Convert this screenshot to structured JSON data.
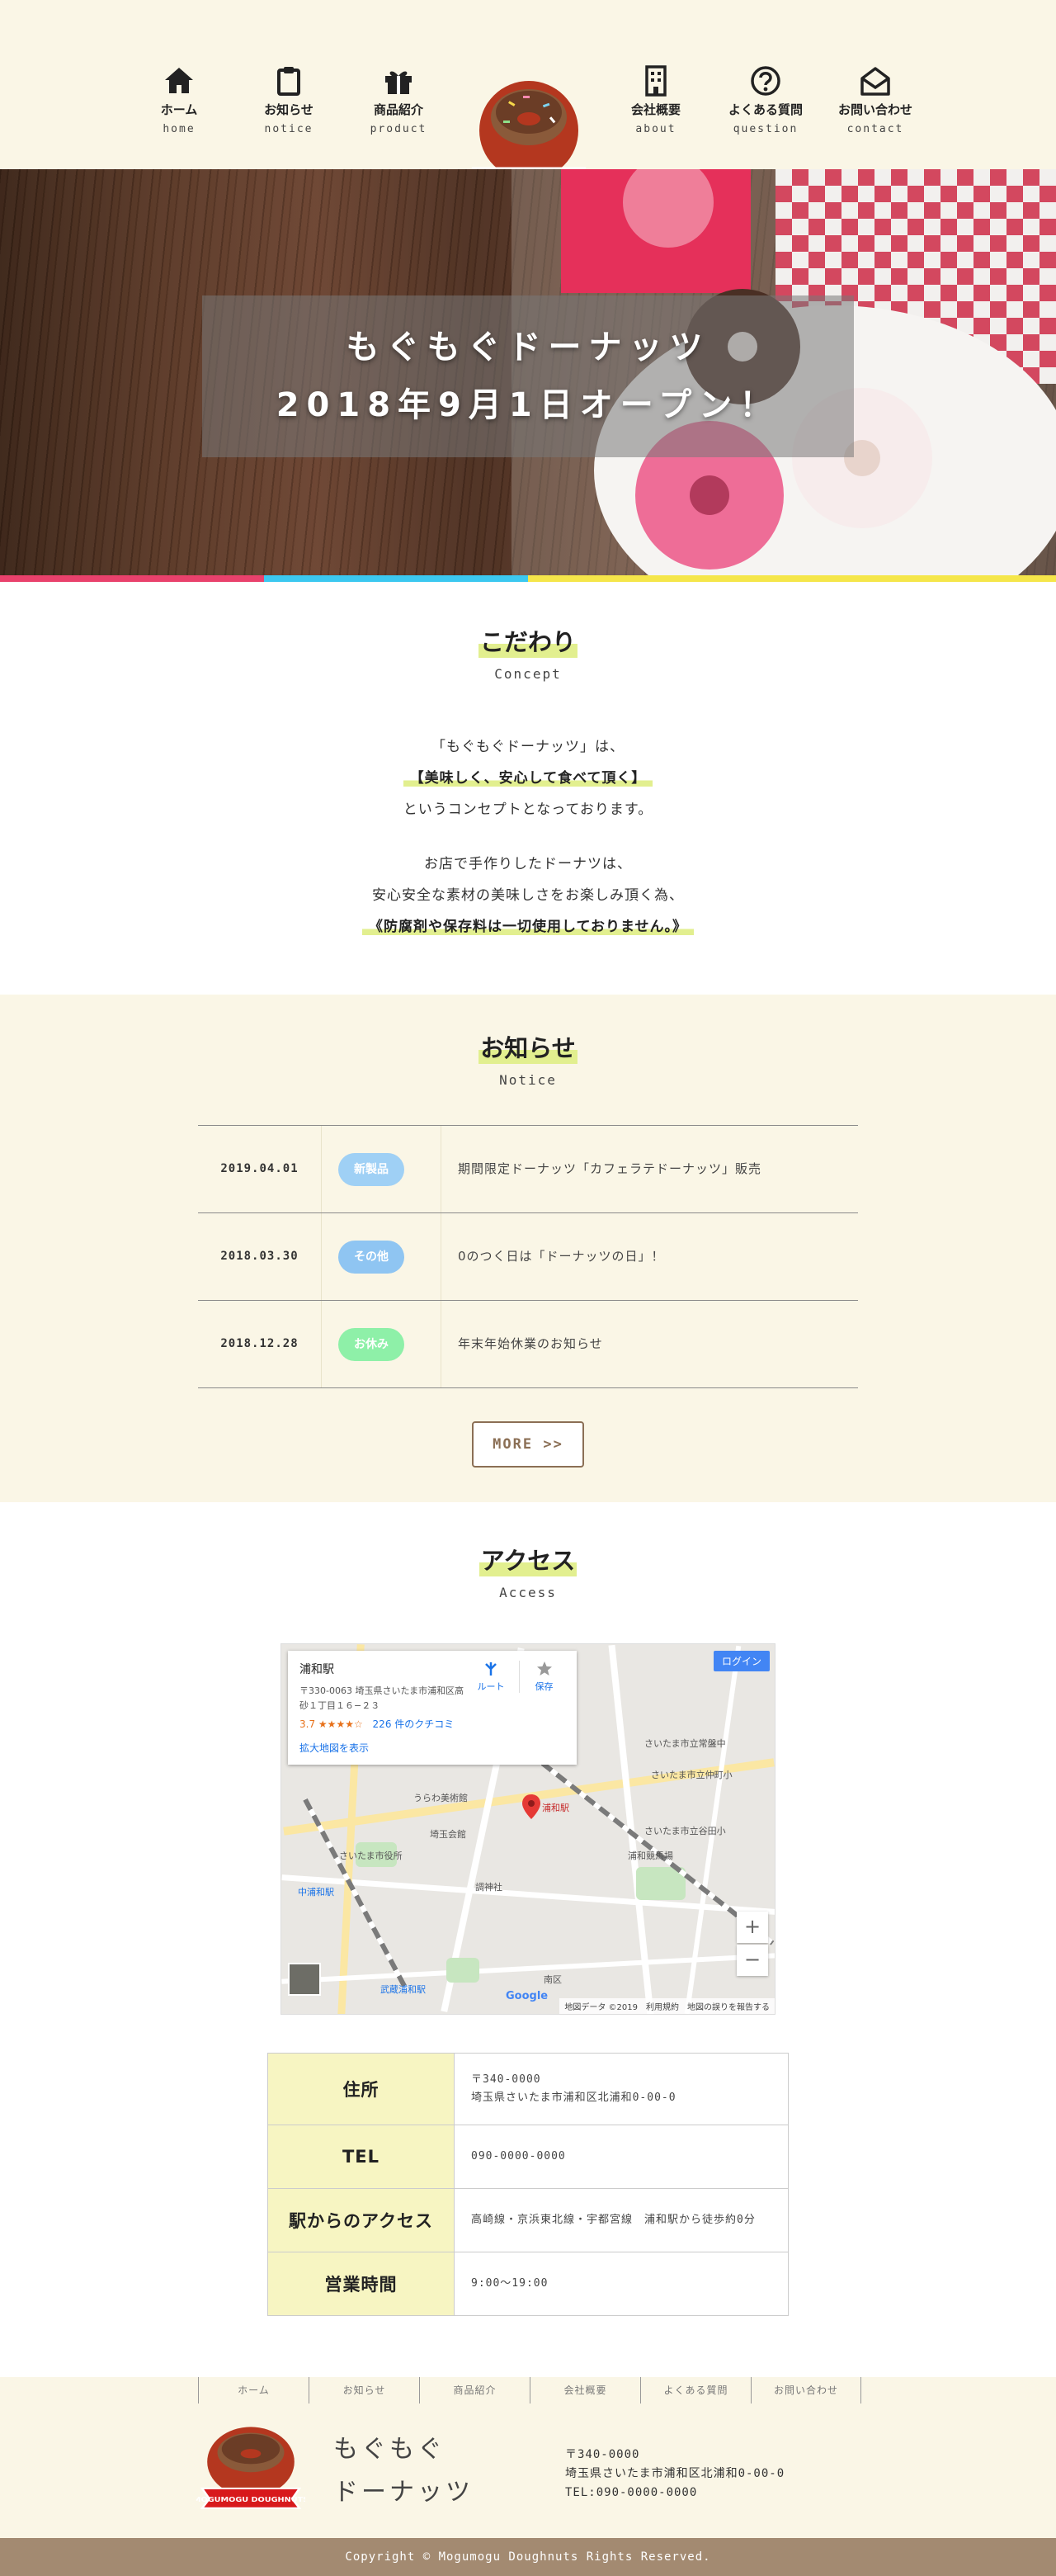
{
  "colors": {
    "cream": "#faf6e6",
    "highlight": "#e2ef8f",
    "brown": "#8b6f55",
    "footer_brown": "#a38a71",
    "badge_new": "#9fd0f5",
    "badge_other": "#8fc5f2",
    "badge_holiday": "#8ef0a8",
    "bar_colors": [
      "#e9416c",
      "#3cc8f0",
      "#f5e64a",
      "#f5e64a"
    ]
  },
  "header": {
    "logo_text": "MOGUMOGU DOUGHNUTS",
    "nav": [
      {
        "jp": "ホーム",
        "en": "home",
        "icon": "home-icon"
      },
      {
        "jp": "お知らせ",
        "en": "notice",
        "icon": "clipboard-icon"
      },
      {
        "jp": "商品紹介",
        "en": "product",
        "icon": "gift-icon"
      },
      {
        "jp": "会社概要",
        "en": "about",
        "icon": "building-icon"
      },
      {
        "jp": "よくある質問",
        "en": "question",
        "icon": "question-icon"
      },
      {
        "jp": "お問い合わせ",
        "en": "contact",
        "icon": "mail-open-icon"
      }
    ]
  },
  "hero": {
    "line1": "もぐもぐドーナッツ",
    "line2": "2018年9月1日オープン！"
  },
  "concept": {
    "title": "こだわり",
    "subtitle": "Concept",
    "p1_line1": "「もぐもぐドーナッツ」は、",
    "p1_line2": "【美味しく、安心して食べて頂く】",
    "p1_line3": "というコンセプトとなっております。",
    "p2_line1": "お店で手作りしたドーナツは、",
    "p2_line2": "安心安全な素材の美味しさをお楽しみ頂く為、",
    "p2_line3": "《防腐剤や保存料は一切使用しておりません。》"
  },
  "notice": {
    "title": "お知らせ",
    "subtitle": "Notice",
    "items": [
      {
        "date": "2019.04.01",
        "badge": "新製品",
        "text": "期間限定ドーナッツ「カフェラテドーナッツ」販売"
      },
      {
        "date": "2018.03.30",
        "badge": "その他",
        "text": "0のつく日は「ドーナッツの日」！"
      },
      {
        "date": "2018.12.28",
        "badge": "お休み",
        "text": "年末年始休業のお知らせ"
      }
    ],
    "more_label": "MORE >>"
  },
  "access": {
    "title": "アクセス",
    "subtitle": "Access",
    "map": {
      "place_name": "浦和駅",
      "place_address": "〒330-0063 埼玉県さいたま市浦和区高砂１丁目１６−２３",
      "rating": "3.7",
      "stars": "★★★★☆",
      "reviews": "226 件のクチコミ",
      "large_map_link": "拡大地図を表示",
      "route_label": "ルート",
      "save_label": "保存",
      "login_label": "ログイン",
      "pin_label": "浦和駅",
      "zoom_in": "+",
      "zoom_out": "−",
      "footer": "地図データ ©2019　利用規約　地図の誤りを報告する",
      "google": "Google",
      "labels": [
        "うらわ美術館",
        "埼玉会館",
        "さいたま市役所",
        "調神社",
        "浦和競馬場",
        "南区",
        "中浦和駅",
        "武蔵浦和駅",
        "さいたま市立谷田小",
        "さいたま市立仲町小",
        "さいたま市立常盤中"
      ]
    },
    "table": [
      {
        "label": "住所",
        "value": "〒340-0000\n埼玉県さいたま市浦和区北浦和0-00-0"
      },
      {
        "label": "TEL",
        "value": "090-0000-0000"
      },
      {
        "label": "駅からのアクセス",
        "value": "高崎線・京浜東北線・宇都宮線　浦和駅から徒歩約0分"
      },
      {
        "label": "営業時間",
        "value": "9:00〜19:00"
      }
    ]
  },
  "footer": {
    "nav": [
      "ホーム",
      "お知らせ",
      "商品紹介",
      "会社概要",
      "よくある質問",
      "お問い合わせ"
    ],
    "name_line1": "もぐもぐ",
    "name_line2": "ドーナッツ",
    "postal": "〒340-0000",
    "address": "埼玉県さいたま市浦和区北浦和0-00-0",
    "tel": "TEL:090-0000-0000",
    "copyright": "Copyright © Mogumogu Doughnuts Rights Reserved."
  }
}
